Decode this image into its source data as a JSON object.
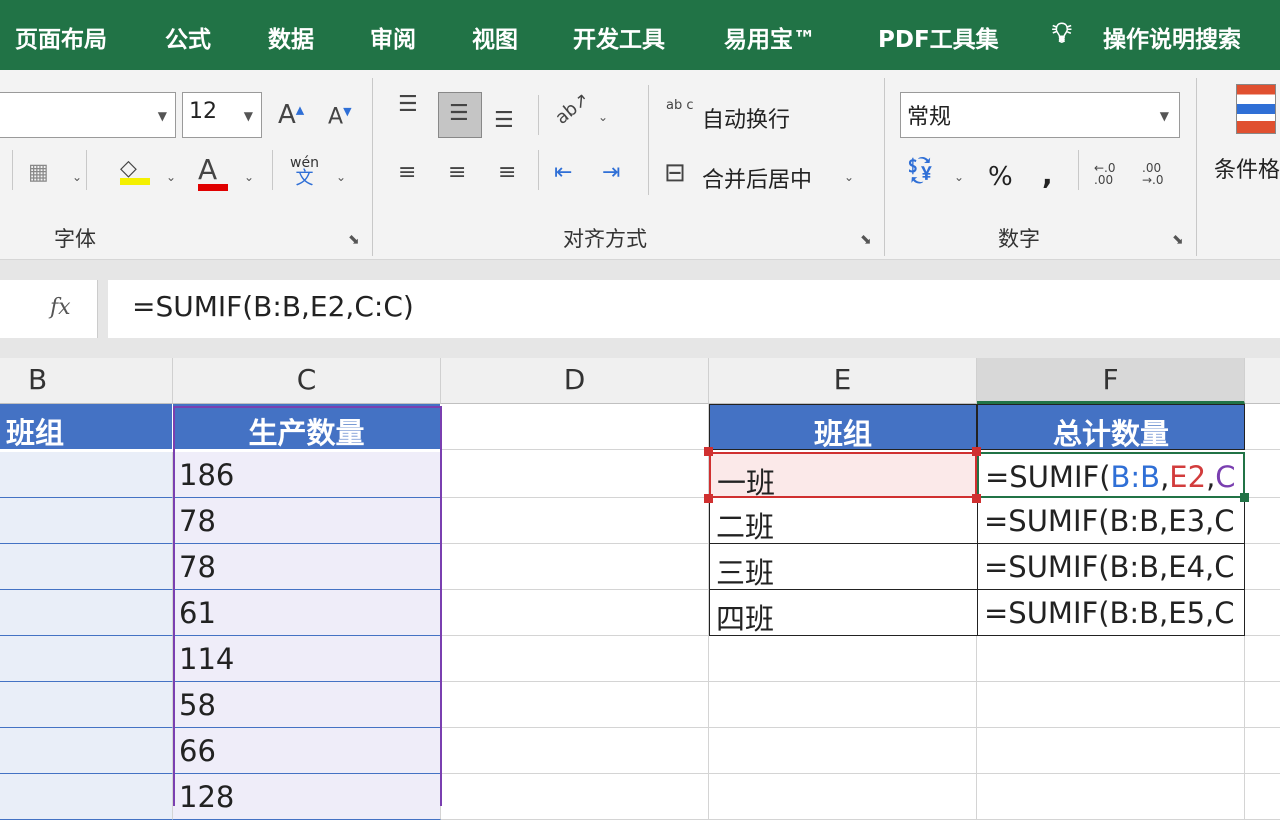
{
  "menu": {
    "tabs": [
      "页面布局",
      "公式",
      "数据",
      "审阅",
      "视图",
      "开发工具",
      "易用宝™",
      "PDF工具集"
    ],
    "search": "操作说明搜索"
  },
  "ribbon": {
    "font_size": "12",
    "font_group": "字体",
    "align_group": "对齐方式",
    "wrap_text": "自动换行",
    "merge_center": "合并后居中",
    "number_format": "常规",
    "number_group": "数字",
    "percent": "%",
    "comma": ",",
    "conditional_format": "条件格",
    "phonetic": "wén",
    "phonetic_char": "文",
    "increase_decimal": "←.0 .00",
    "decrease_decimal": ".00 →.0",
    "wrap_icon": "ab c"
  },
  "formula_bar": {
    "fx": "fx",
    "formula": "=SUMIF(B:B,E2,C:C)"
  },
  "columns": [
    "B",
    "C",
    "D",
    "E",
    "F"
  ],
  "sheet": {
    "b_header": "班组",
    "c_header": "生产数量",
    "c_values": [
      "186",
      "78",
      "78",
      "61",
      "114",
      "58",
      "66",
      "128"
    ],
    "e_header": "班组",
    "f_header": "总计数量",
    "summary": [
      {
        "group": "一班",
        "formula_parts": [
          "=SUMIF(",
          "B:B",
          ",",
          "E2",
          ",",
          "C"
        ]
      },
      {
        "group": "二班",
        "formula": "=SUMIF(B:B,E3,C"
      },
      {
        "group": "三班",
        "formula": "=SUMIF(B:B,E4,C"
      },
      {
        "group": "四班",
        "formula": "=SUMIF(B:B,E5,C"
      }
    ]
  },
  "colors": {
    "menubar": "#217346",
    "header_fill": "#4472c4",
    "ref_blue": "#2f6fd6",
    "ref_red": "#d23c3c",
    "ref_purple": "#7a3fb0"
  }
}
